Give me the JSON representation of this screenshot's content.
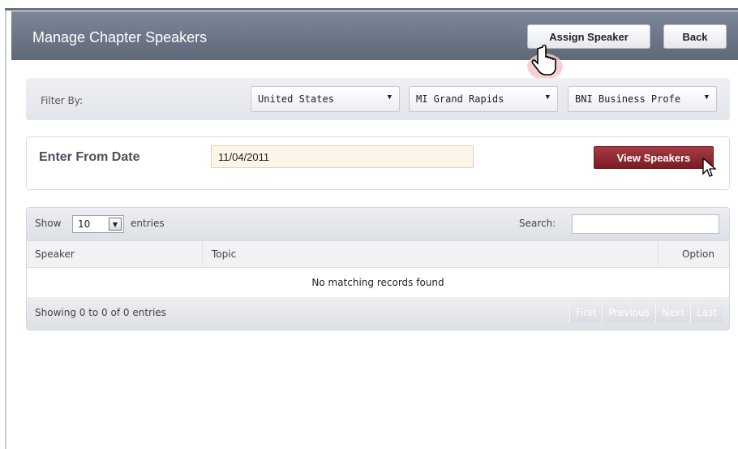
{
  "header": {
    "title": "Manage Chapter Speakers",
    "assign_button": "Assign Speaker",
    "back_button": "Back"
  },
  "filter": {
    "label": "Filter By:",
    "country": "United States",
    "region": "MI Grand Rapids",
    "chapter": "BNI Business Profe"
  },
  "date_form": {
    "label": "Enter From Date",
    "value": "11/04/2011",
    "view_button": "View Speakers"
  },
  "table": {
    "show_label": "Show",
    "page_length": "10",
    "entries_label": "entries",
    "search_label": "Search:",
    "search_value": "",
    "columns": [
      "Speaker",
      "Topic",
      "Option"
    ],
    "empty_message": "No matching records found",
    "info": "Showing 0 to 0 of 0 entries",
    "pager": [
      "First",
      "Previous",
      "Next",
      "Last"
    ]
  },
  "icons": {
    "dropdown": "chevron-down-icon",
    "cursor_hand": "hand-pointer-icon",
    "cursor_arrow": "arrow-pointer-icon"
  },
  "colors": {
    "header_bg": "#6e7888",
    "view_button_bg": "#8e2a32",
    "date_input_bg": "#fdf6e8"
  }
}
